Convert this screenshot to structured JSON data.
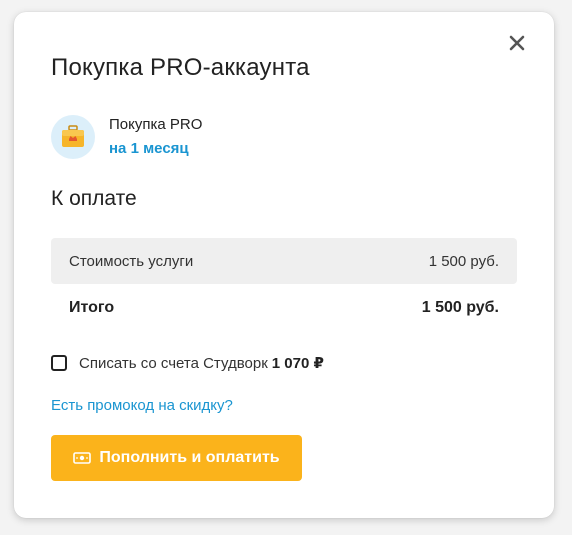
{
  "dialog": {
    "title": "Покупка PRO-аккаунта",
    "close_icon": "close-icon"
  },
  "product": {
    "icon": "briefcase-crown-icon",
    "name": "Покупка PRO",
    "period": "на 1 месяц"
  },
  "payment": {
    "heading": "К оплате",
    "cost_label": "Стоимость услуги",
    "cost_value": "1 500 руб.",
    "total_label": "Итого",
    "total_value": "1 500 руб."
  },
  "balance": {
    "checked": false,
    "label": "Списать со счета Студворк",
    "amount": "1 070 ₽"
  },
  "promo_link": "Есть промокод на скидку?",
  "pay_button": {
    "icon": "cash-icon",
    "label": "Пополнить и оплатить"
  },
  "colors": {
    "accent_blue": "#1a95d1",
    "button_yellow": "#fbb31b",
    "row_gray": "#efefef"
  }
}
